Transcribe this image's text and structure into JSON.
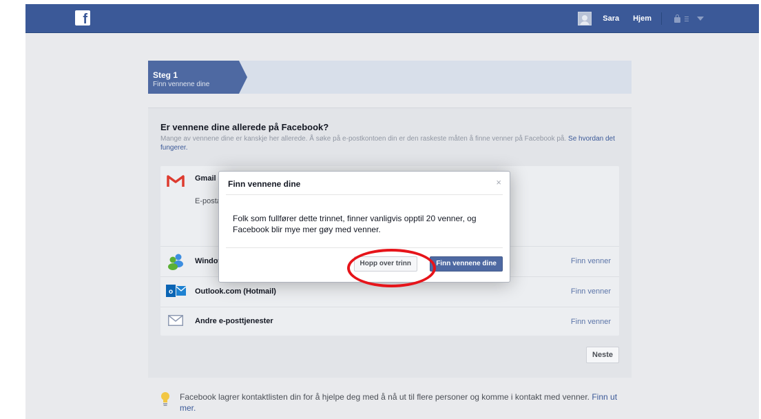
{
  "topbar": {
    "user_name": "Sara",
    "home_label": "Hjem"
  },
  "steps": {
    "active_title": "Steg 1",
    "active_subtitle": "Finn vennene dine"
  },
  "card": {
    "title": "Er vennene dine allerede på Facebook?",
    "description": "Mange av vennene dine er kanskje her allerede. Å søke på e-postkontoen din er den raskeste måten å finne venner på Facebook på.",
    "help_link": "Se hvordan det fungerer.",
    "providers": [
      {
        "name": "Gmail",
        "icon": "gmail-icon",
        "field_label": "E-postadres"
      },
      {
        "name": "Windows Live",
        "icon": "windows-live-icon",
        "action": "Finn venner"
      },
      {
        "name": "Outlook.com (Hotmail)",
        "icon": "outlook-icon",
        "action": "Finn venner"
      },
      {
        "name": "Andre e-posttjenester",
        "icon": "mail-icon",
        "action": "Finn venner"
      }
    ],
    "next_label": "Neste"
  },
  "footer": {
    "text": "Facebook lagrer kontaktlisten din for å hjelpe deg med å nå ut til flere personer og komme i kontakt med venner.",
    "link": "Finn ut mer."
  },
  "dialog": {
    "title": "Finn vennene dine",
    "close": "×",
    "body": "Folk som fullfører dette trinnet, finner vanligvis opptil 20 venner, og Facebook blir mye mer gøy med venner.",
    "skip_label": "Hopp over trinn",
    "confirm_label": "Finn vennene dine"
  },
  "colors": {
    "brand": "#3b5998",
    "annotation": "#e6141a"
  }
}
